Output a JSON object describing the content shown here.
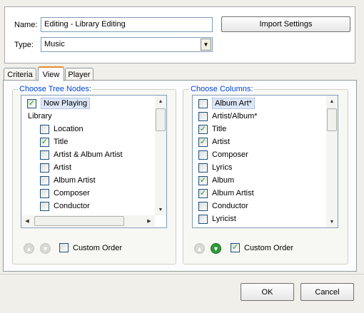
{
  "name_field": {
    "label": "Name:",
    "value": "Editing - Library Editing"
  },
  "type_field": {
    "label": "Type:",
    "value": "Music"
  },
  "import_button": "Import Settings",
  "tabs": [
    "Criteria",
    "View",
    "Player"
  ],
  "tree_nodes": {
    "title": "Choose Tree Nodes:",
    "items": [
      {
        "label": "Now Playing",
        "checked": true,
        "level": 0,
        "checkbox": true,
        "highlight": true
      },
      {
        "label": "Library",
        "checked": false,
        "level": 0,
        "checkbox": false
      },
      {
        "label": "Location",
        "checked": false,
        "level": 1,
        "checkbox": true
      },
      {
        "label": "Title",
        "checked": true,
        "level": 1,
        "checkbox": true
      },
      {
        "label": "Artist & Album Artist",
        "checked": false,
        "level": 1,
        "checkbox": true
      },
      {
        "label": "Artist",
        "checked": false,
        "level": 1,
        "checkbox": true
      },
      {
        "label": "Album Artist",
        "checked": false,
        "level": 1,
        "checkbox": true
      },
      {
        "label": "Composer",
        "checked": false,
        "level": 1,
        "checkbox": true
      },
      {
        "label": "Conductor",
        "checked": false,
        "level": 1,
        "checkbox": true
      }
    ],
    "custom_order": {
      "label": "Custom Order",
      "checked": false
    }
  },
  "columns": {
    "title": "Choose Columns:",
    "items": [
      {
        "label": "Album Art*",
        "checked": false,
        "highlight": true
      },
      {
        "label": "Artist/Album*",
        "checked": false
      },
      {
        "label": "Title",
        "checked": true
      },
      {
        "label": "Artist",
        "checked": true
      },
      {
        "label": "Composer",
        "checked": false
      },
      {
        "label": "Lyrics",
        "checked": false
      },
      {
        "label": "Album",
        "checked": true
      },
      {
        "label": "Album Artist",
        "checked": true
      },
      {
        "label": "Conductor",
        "checked": false
      },
      {
        "label": "Lyricist",
        "checked": false
      }
    ],
    "custom_order": {
      "label": "Custom Order",
      "checked": true
    }
  },
  "buttons": {
    "ok": "OK",
    "cancel": "Cancel"
  },
  "colors": {
    "accent": "#e68b2c",
    "group_title": "#0046d5",
    "check": "#21a121"
  }
}
